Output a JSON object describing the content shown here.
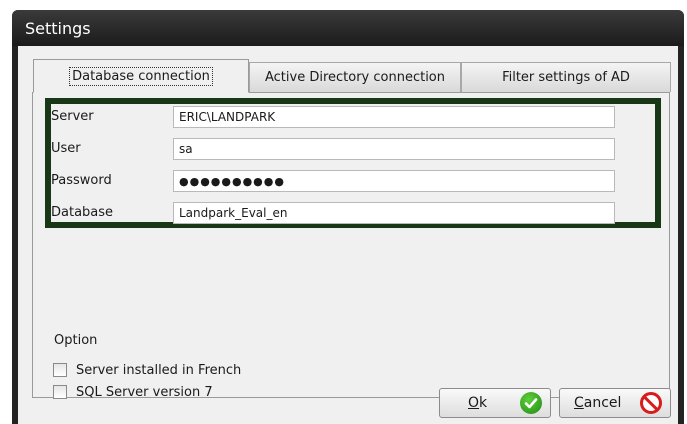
{
  "window": {
    "title": "Settings"
  },
  "tabs": [
    {
      "label": "Database connection",
      "active": true
    },
    {
      "label": "Active Directory connection",
      "active": false
    },
    {
      "label": "Filter settings of AD",
      "active": false
    }
  ],
  "fields": {
    "server": {
      "label": "Server",
      "value": "ERIC\\LANDPARK"
    },
    "user": {
      "label": "User",
      "value": "sa"
    },
    "password": {
      "label": "Password",
      "value": "●●●●●●●●●●"
    },
    "database": {
      "label": "Database",
      "value": "Landpark_Eval_en"
    }
  },
  "options": {
    "label": "Option",
    "items": [
      {
        "label": "Server installed in French",
        "checked": false
      },
      {
        "label": "SQL Server version 7",
        "checked": false
      }
    ]
  },
  "buttons": {
    "ok": {
      "mnemonic": "O",
      "rest": "k",
      "icon": "check-circle-icon"
    },
    "cancel": {
      "mnemonic": "C",
      "rest": "ancel",
      "icon": "no-entry-icon"
    }
  },
  "colors": {
    "highlight_border": "#173717",
    "title_bar": "#232323"
  }
}
